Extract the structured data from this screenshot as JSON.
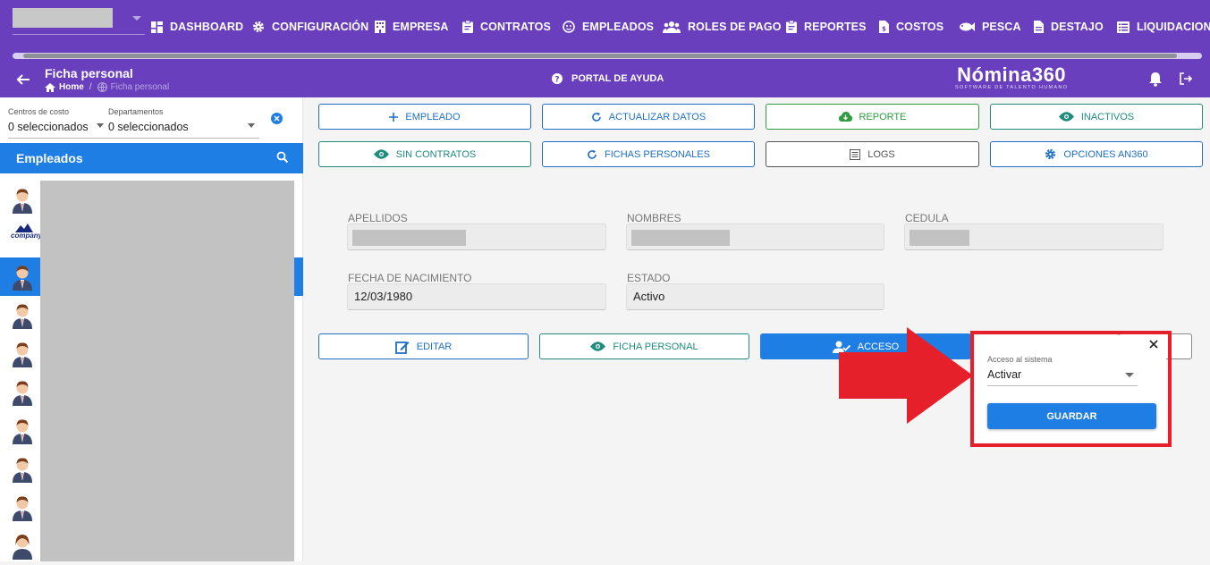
{
  "colors": {
    "brand": "#6a3fbe",
    "accent": "#1f7ee4",
    "green": "#2e9c3f",
    "teal": "#1f8c7e",
    "highlight": "#e5202a"
  },
  "nav": {
    "items": [
      {
        "label": "DASHBOARD",
        "icon": "dashboard-icon"
      },
      {
        "label": "CONFIGURACIÓN",
        "icon": "gear-icon"
      },
      {
        "label": "EMPRESA",
        "icon": "building-icon"
      },
      {
        "label": "CONTRATOS",
        "icon": "clipboard-icon"
      },
      {
        "label": "EMPLEADOS",
        "icon": "face-icon"
      },
      {
        "label": "ROLES DE PAGO",
        "icon": "group-icon"
      },
      {
        "label": "REPORTES",
        "icon": "clipboard-icon"
      },
      {
        "label": "COSTOS",
        "icon": "document-dollar-icon"
      },
      {
        "label": "PESCA",
        "icon": "fish-icon"
      },
      {
        "label": "DESTAJO",
        "icon": "document-icon"
      },
      {
        "label": "LIQUIDACION",
        "icon": "list-icon"
      }
    ]
  },
  "subheader": {
    "title": "Ficha personal",
    "breadcrumb_home": "Home",
    "breadcrumb_current": "Ficha personal",
    "help_label": "PORTAL DE AYUDA",
    "logo_main": "Nómina360",
    "logo_tagline": "SOFTWARE DE TALENTO HUMANO"
  },
  "sidebar": {
    "cost_centers_label": "Centros de costo",
    "cost_centers_value": "0 seleccionados",
    "departments_label": "Departamentos",
    "departments_value": "0 seleccionados",
    "list_title": "Empleados",
    "company_logo_text": "company"
  },
  "toolbar": {
    "empleado": "EMPLEADO",
    "actualizar": "ACTUALIZAR DATOS",
    "reporte": "REPORTE",
    "inactivos": "INACTIVOS",
    "sin_contratos": "SIN CONTRATOS",
    "fichas": "FICHAS PERSONALES",
    "logs": "LOGS",
    "opciones": "OPCIONES AN360"
  },
  "form": {
    "apellidos_label": "APELLIDOS",
    "nombres_label": "NOMBRES",
    "cedula_label": "CEDULA",
    "nacimiento_label": "FECHA DE NACIMIENTO",
    "nacimiento_value": "12/03/1980",
    "estado_label": "ESTADO",
    "estado_value": "Activo"
  },
  "actions": {
    "editar": "EDITAR",
    "ficha": "FICHA PERSONAL",
    "acceso": "ACCESO"
  },
  "popup": {
    "label": "Acceso al sistema",
    "value": "Activar",
    "save": "GUARDAR"
  }
}
